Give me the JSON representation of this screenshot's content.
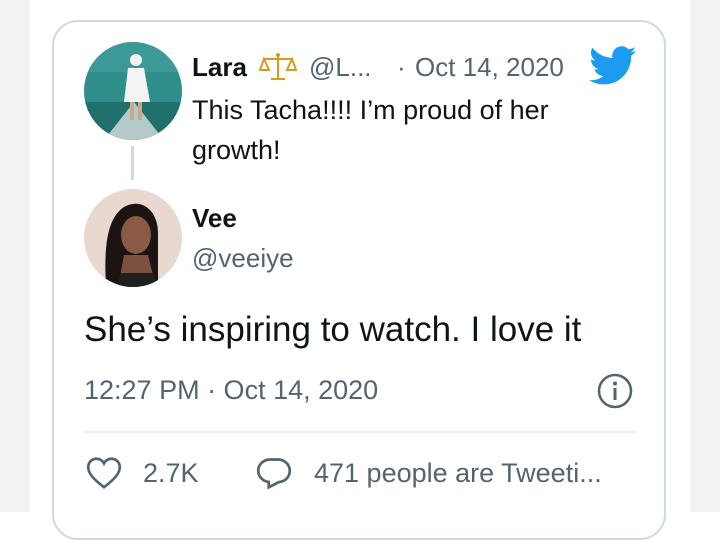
{
  "quoted_tweet": {
    "author_name": "Lara",
    "author_handle": "@L...",
    "separator": "·",
    "date": "Oct 14, 2020",
    "text": "This Tacha!!!! I’m proud of her growth!"
  },
  "tweet": {
    "author_name": "Vee",
    "author_handle": "@veeiye",
    "text": "She’s inspiring to watch. I love it",
    "timestamp": "12:27 PM · Oct 14, 2020"
  },
  "actions": {
    "likes": "2.7K",
    "replies": "471 people are Tweeti..."
  },
  "colors": {
    "twitter_blue": "#1d9bf0",
    "secondary_text": "#536471",
    "border": "#cfd9de"
  },
  "icons": [
    "scales-icon",
    "twitter-bird-icon",
    "info-icon",
    "heart-icon",
    "reply-bubble-icon"
  ]
}
